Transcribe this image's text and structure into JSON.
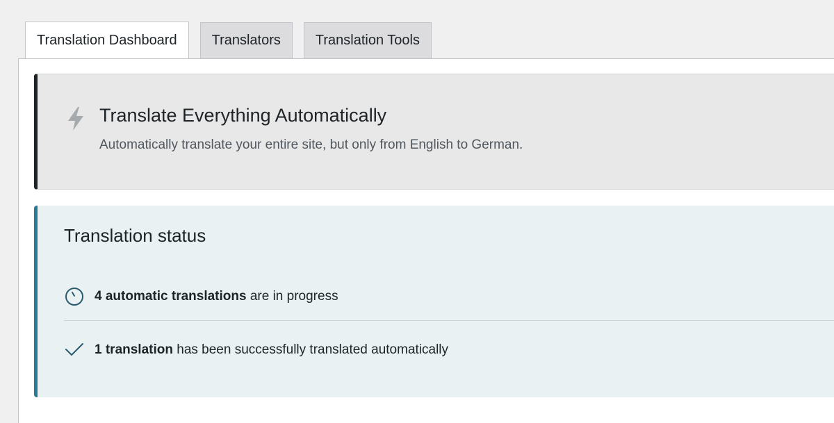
{
  "tabs": [
    {
      "label": "Translation Dashboard",
      "active": true
    },
    {
      "label": "Translators",
      "active": false
    },
    {
      "label": "Translation Tools",
      "active": false
    }
  ],
  "automatic_card": {
    "icon": "lightning-bolt-icon",
    "title": "Translate Everything Automatically",
    "description": "Automatically translate your entire site, but only from English to German."
  },
  "status_card": {
    "title": "Translation status",
    "rows": [
      {
        "icon": "progress-clock-icon",
        "bold": "4 automatic translations",
        "rest": " are in progress"
      },
      {
        "icon": "checkmark-icon",
        "bold": "1 translation",
        "rest": " has been successfully translated automatically"
      }
    ]
  },
  "colors": {
    "accent": "#2a7a93",
    "card_border_dark": "#1d2327",
    "status_bg": "#e9f1f3"
  }
}
